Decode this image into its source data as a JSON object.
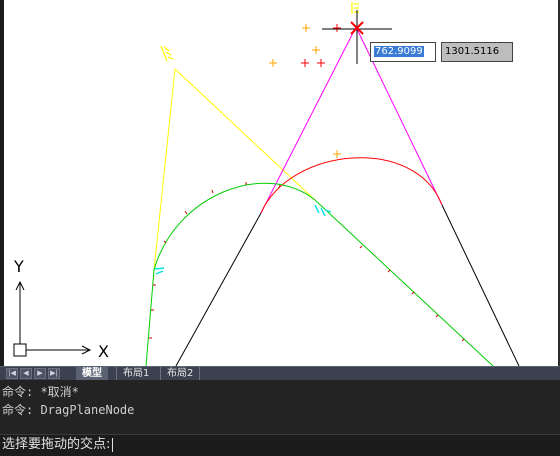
{
  "drawing": {
    "colors": {
      "background": "#ffffff",
      "yellow": "#ffff00",
      "magenta": "#ff00ff",
      "red": "#ff0000",
      "green": "#00ff00",
      "black": "#000000",
      "cyan": "#00ffff",
      "orange_marker": "#ffa500"
    },
    "ucs_icon": {
      "x_label": "X",
      "y_label": "Y"
    },
    "dynamic_input": {
      "x_value": "762.9099",
      "y_value": "1301.5116"
    }
  },
  "layout_tabs": {
    "nav_buttons": [
      "first-icon",
      "prev-icon",
      "next-icon",
      "last-icon"
    ],
    "tabs": [
      {
        "label": "模型",
        "active": true
      },
      {
        "label": "布局1",
        "active": false
      },
      {
        "label": "布局2",
        "active": false
      }
    ]
  },
  "command_line": {
    "history": [
      "命令: *取消*",
      "命令: DragPlaneNode"
    ],
    "prompt": "选择要拖动的交点:"
  }
}
